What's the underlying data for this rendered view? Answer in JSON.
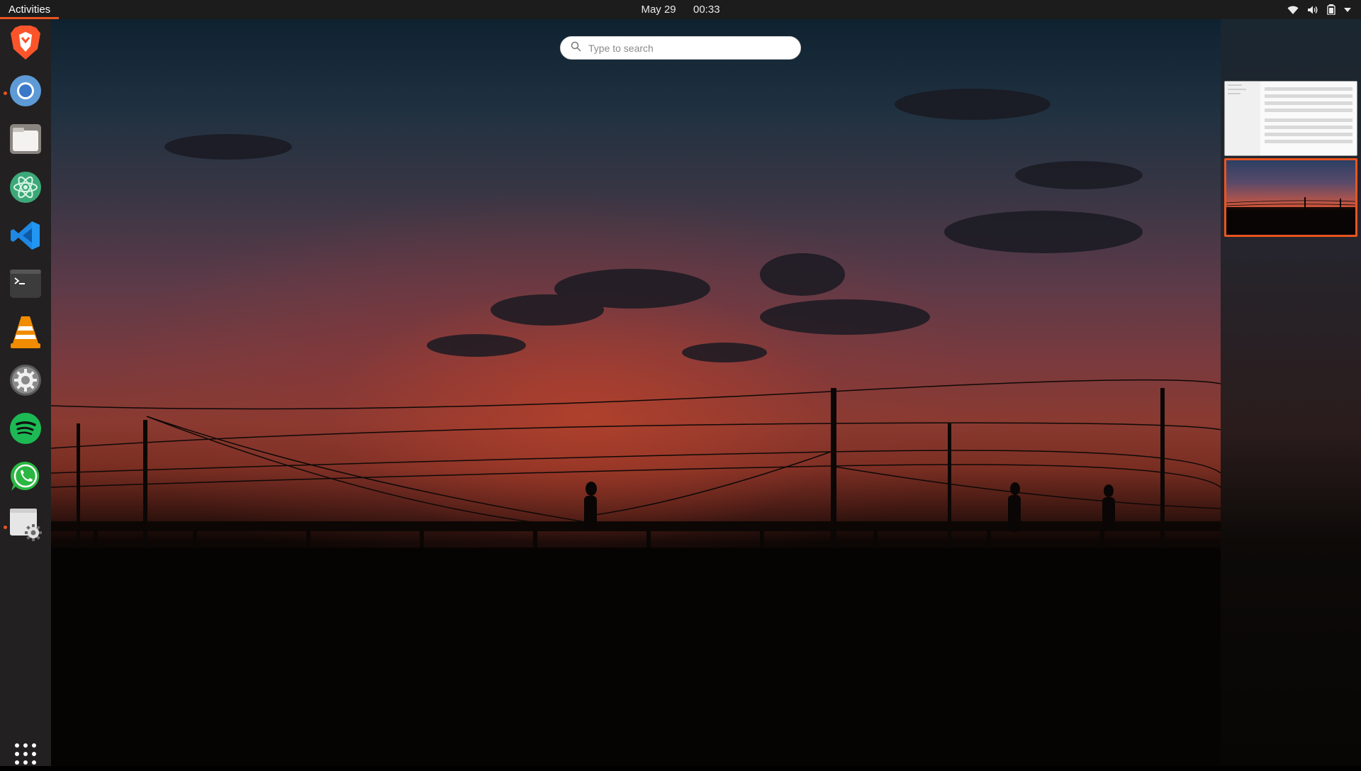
{
  "topbar": {
    "activities_label": "Activities",
    "date": "May 29",
    "time": "00:33",
    "tray_icons": [
      "wifi-icon",
      "volume-icon",
      "battery-icon",
      "system-menu-arrow-icon"
    ]
  },
  "search": {
    "placeholder": "Type to search"
  },
  "dock": {
    "items": [
      {
        "name": "brave-browser",
        "icon": "brave-icon",
        "running": false
      },
      {
        "name": "chromium",
        "icon": "chromium-icon",
        "running": true
      },
      {
        "name": "files",
        "icon": "files-icon",
        "running": false
      },
      {
        "name": "atom",
        "icon": "atom-icon",
        "running": false
      },
      {
        "name": "vscode",
        "icon": "vscode-icon",
        "running": false
      },
      {
        "name": "terminal",
        "icon": "terminal-icon",
        "running": false
      },
      {
        "name": "vlc",
        "icon": "vlc-icon",
        "running": false
      },
      {
        "name": "system-settings",
        "icon": "settings-icon",
        "running": false
      },
      {
        "name": "spotify",
        "icon": "spotify-icon",
        "running": false
      },
      {
        "name": "whatsapp",
        "icon": "whatsapp-icon",
        "running": false
      },
      {
        "name": "software-settings",
        "icon": "software-properties-icon",
        "running": true
      }
    ],
    "show_apps_icon": "show-applications-icon"
  },
  "workspaces": {
    "count": 2,
    "active_index": 1
  },
  "colors": {
    "accent": "#e95420",
    "topbar": "#1c1c1c",
    "dock": "#222020"
  }
}
